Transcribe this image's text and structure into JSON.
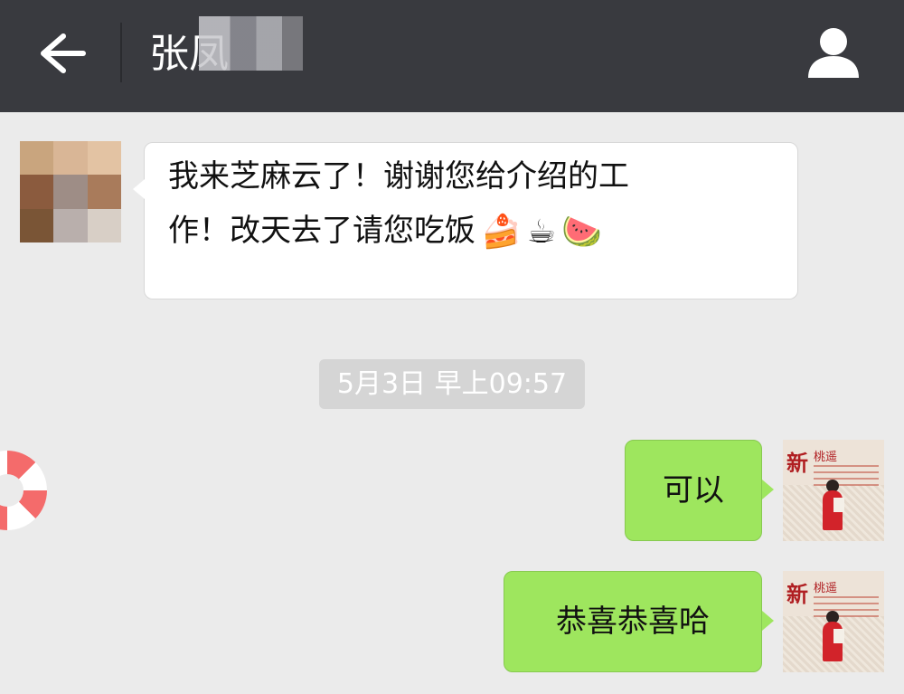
{
  "header": {
    "title": "张凤",
    "back_icon": "arrow-left-icon",
    "profile_icon": "person-icon",
    "background": "#393a3f"
  },
  "messages": [
    {
      "direction": "incoming",
      "line1": "我来芝麻云了！谢谢您给介绍的工",
      "line2": "作！改天去了请您吃饭",
      "emojis": [
        "🍰",
        "☕",
        "🍉"
      ]
    },
    {
      "direction": "outgoing",
      "text": "可以"
    },
    {
      "direction": "outgoing",
      "text": "恭喜恭喜哈"
    }
  ],
  "timestamp": "5月3日 早上09:57",
  "avatar_right": {
    "brand": "新",
    "brand_sub": "桃遥"
  },
  "colors": {
    "chat_background": "#ebebeb",
    "outgoing_bubble": "#9ee65e",
    "incoming_bubble": "#ffffff",
    "timestamp_bg": "#d5d5d5"
  }
}
